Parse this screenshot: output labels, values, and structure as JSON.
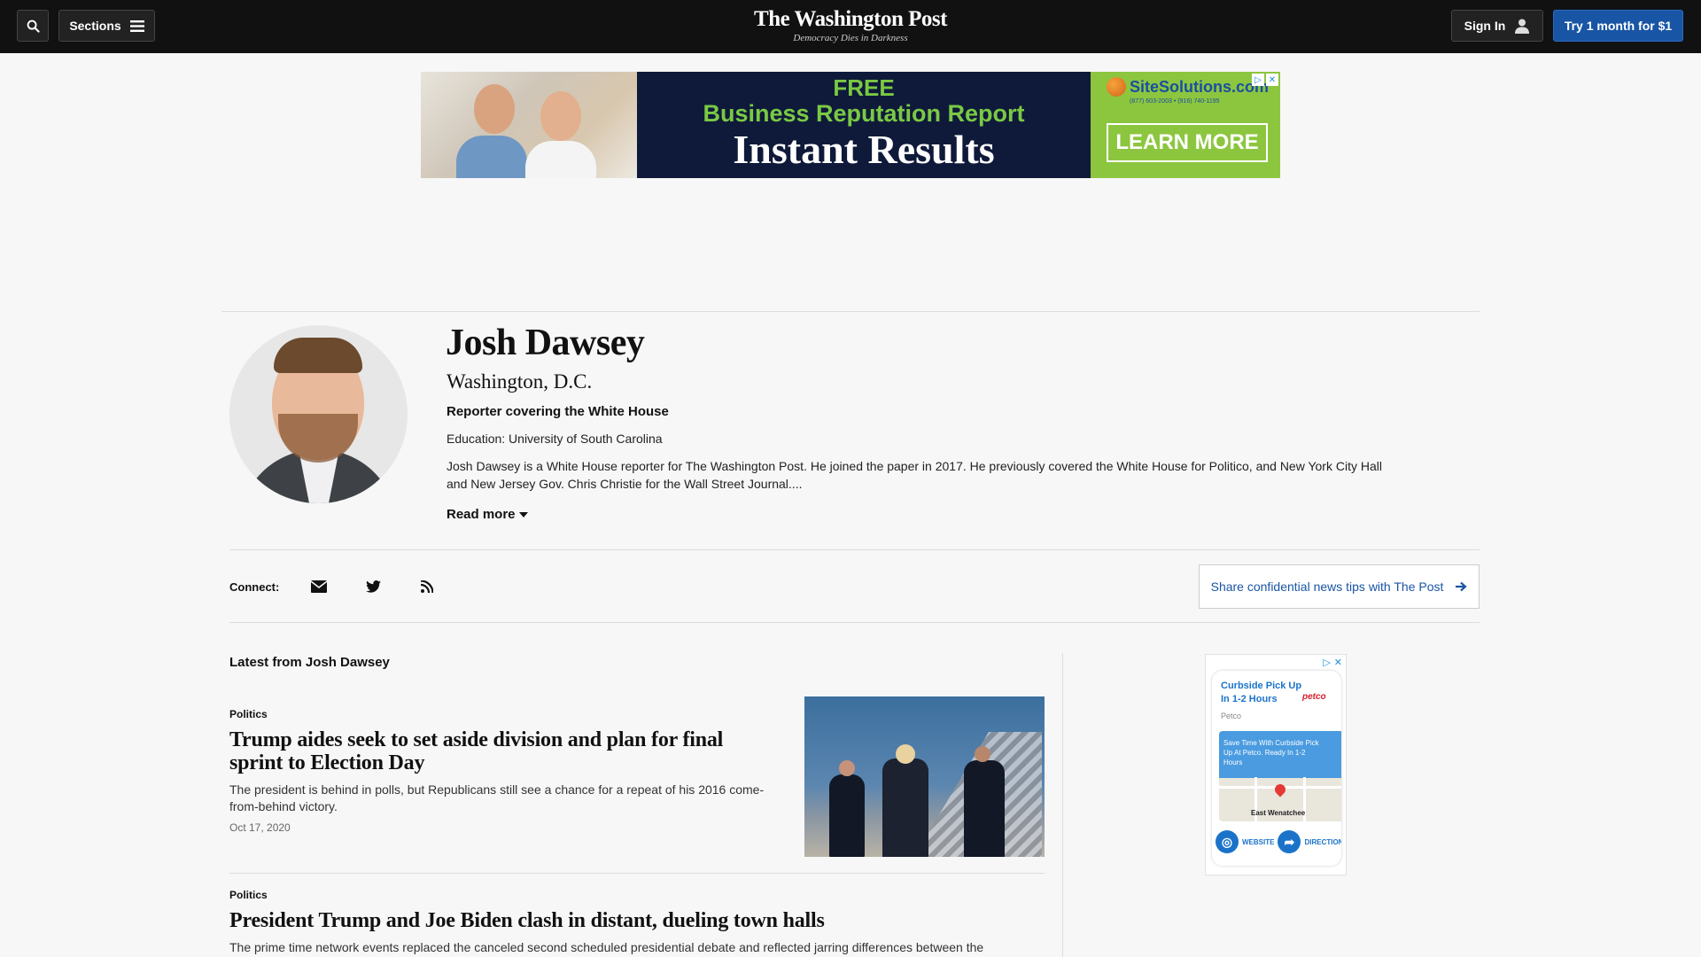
{
  "nav": {
    "sections_label": "Sections",
    "logo_name": "The Washington Post",
    "logo_tagline": "Democracy Dies in Darkness",
    "signin_label": "Sign In",
    "try_label": "Try 1 month for $1"
  },
  "banner_ad": {
    "line1": "FREE",
    "line2": "Business Reputation Report",
    "line3": "Instant Results",
    "brand": "SiteSolutions.com",
    "phone": "(877) 603-2003 • (916) 740-1195",
    "cta": "LEARN MORE"
  },
  "profile": {
    "name": "Josh Dawsey",
    "location": "Washington, D.C.",
    "role": "Reporter covering the White House",
    "education": "Education: University of South Carolina",
    "bio": "Josh Dawsey is a White House reporter for The Washington Post. He joined the paper in 2017. He previously covered the White House for Politico, and New York City Hall and New Jersey Gov. Chris Christie for the Wall Street Journal....",
    "read_more": "Read more"
  },
  "connect": {
    "label": "Connect:",
    "tips_label": "Share confidential news tips with The Post"
  },
  "latest": {
    "heading": "Latest from Josh Dawsey",
    "articles": [
      {
        "kicker": "Politics",
        "headline": "Trump aides seek to set aside division and plan for final sprint to Election Day",
        "blurb": "The president is behind in polls, but Republicans still see a chance for a repeat of his 2016 come-from-behind victory.",
        "date": "Oct 17, 2020"
      },
      {
        "kicker": "Politics",
        "headline": "President Trump and Joe Biden clash in distant, dueling town halls",
        "blurb": "The prime time network events replaced the canceled second scheduled presidential debate and reflected jarring differences between the"
      }
    ]
  },
  "side_ad": {
    "title": "Curbside Pick Up In 1-2 Hours",
    "brand": "petco",
    "sub": "Petco",
    "map_text": "Save Time With Curbside Pick Up At Petco. Ready In 1-2 Hours",
    "map_label": "East Wenatchee",
    "website": "WEBSITE",
    "directions": "DIRECTIONS"
  },
  "colors": {
    "nav_bg": "#111111",
    "accent_blue": "#1955a5",
    "page_bg": "#f7f7f7"
  }
}
